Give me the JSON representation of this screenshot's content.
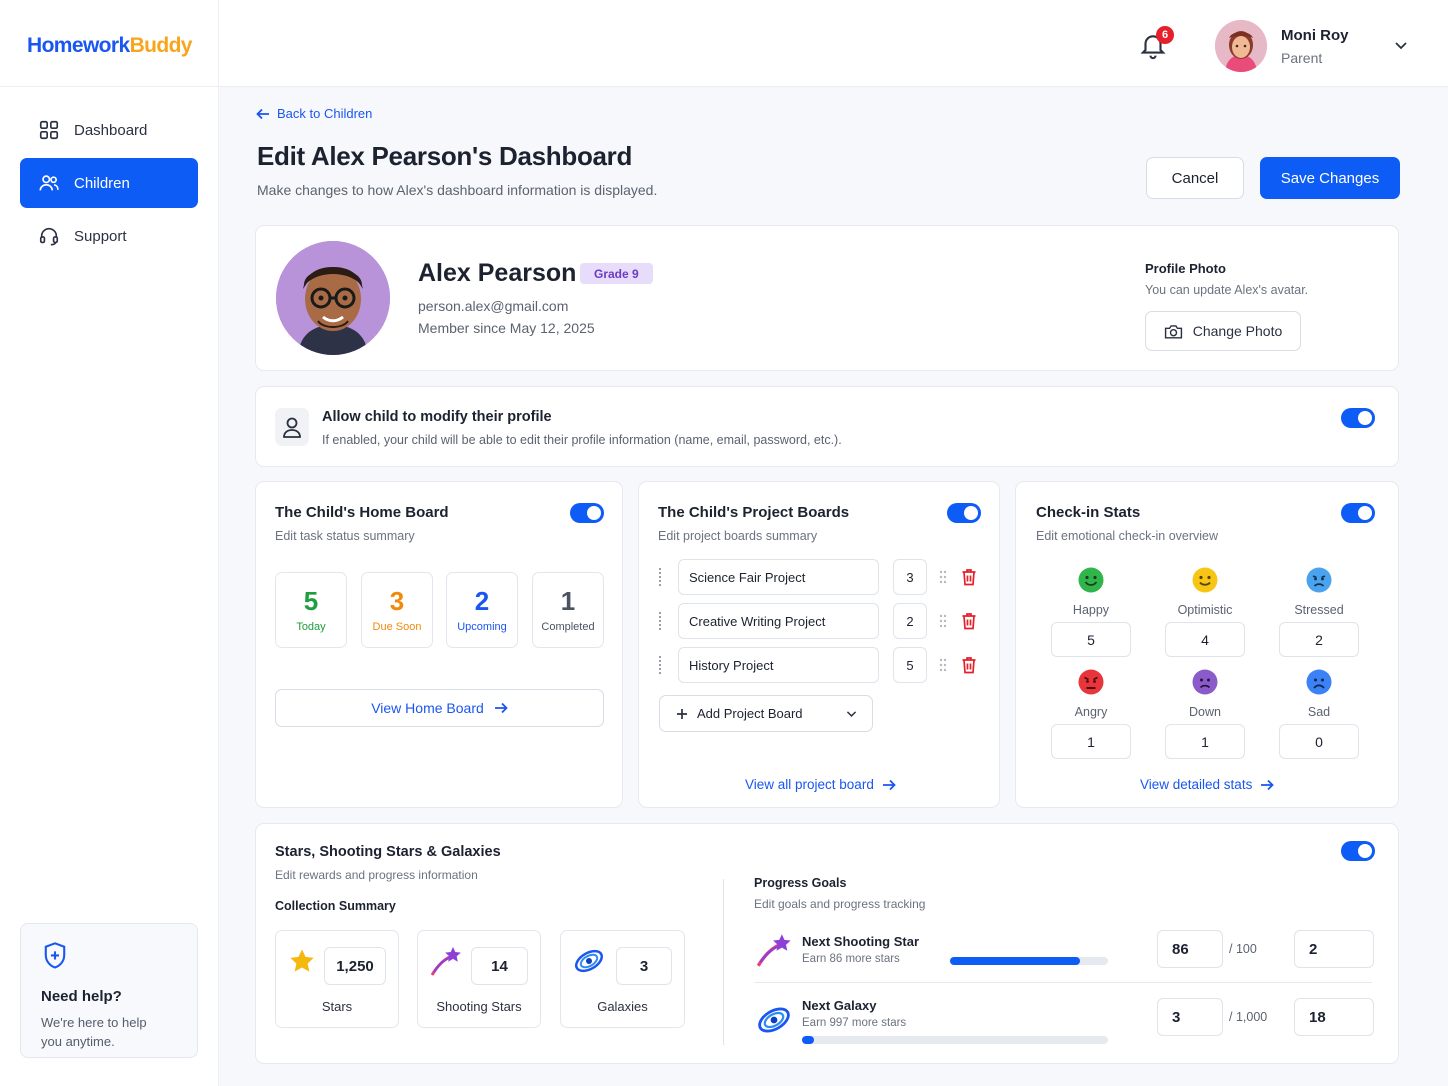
{
  "brand": {
    "part1": "Homework",
    "part2": "Buddy"
  },
  "sidebar": {
    "items": [
      {
        "label": "Dashboard",
        "icon": "grid-icon"
      },
      {
        "label": "Children",
        "icon": "users-icon"
      },
      {
        "label": "Support",
        "icon": "headset-icon"
      }
    ],
    "help": {
      "title": "Need help?",
      "text": "We're here to help you anytime."
    }
  },
  "header": {
    "notifications": "6",
    "user_name": "Moni Roy",
    "user_role": "Parent"
  },
  "page": {
    "back_label": "Back to Children",
    "title": "Edit Alex Pearson's Dashboard",
    "subtitle": "Make changes to how Alex's dashboard information is displayed.",
    "cancel_label": "Cancel",
    "save_label": "Save Changes"
  },
  "profile": {
    "name": "Alex Pearson",
    "grade": "Grade 9",
    "email": "person.alex@gmail.com",
    "member_since": "Member since May 12, 2025",
    "photo_title": "Profile Photo",
    "photo_text": "You can update Alex's avatar.",
    "change_photo_label": "Change Photo"
  },
  "permission": {
    "title": "Allow child to modify their profile",
    "text": "If enabled, your child will be able to edit their profile information (name, email, password, etc.).",
    "enabled": true
  },
  "home_board": {
    "title": "The Child's Home Board",
    "subtitle": "Edit task status summary",
    "enabled": true,
    "stats": [
      {
        "value": "5",
        "label": "Today",
        "color": "#1f9d3f"
      },
      {
        "value": "3",
        "label": "Due Soon",
        "color": "#f08a0c"
      },
      {
        "value": "2",
        "label": "Upcoming",
        "color": "#1a56f0"
      },
      {
        "value": "1",
        "label": "Completed",
        "color": "#4b5261"
      }
    ],
    "view_label": "View Home Board"
  },
  "project_boards": {
    "title": "The Child's Project Boards",
    "subtitle": "Edit project boards summary",
    "enabled": true,
    "projects": [
      {
        "name": "Science Fair Project",
        "count": "3"
      },
      {
        "name": "Creative Writing Project",
        "count": "2"
      },
      {
        "name": "History Project",
        "count": "5"
      }
    ],
    "add_label": "Add Project Board",
    "view_label": "View all project board"
  },
  "checkin": {
    "title": "Check-in Stats",
    "subtitle": "Edit emotional check-in overview",
    "enabled": true,
    "moods": [
      {
        "label": "Happy",
        "value": "5",
        "color": "#2fb54a"
      },
      {
        "label": "Optimistic",
        "value": "4",
        "color": "#f6c515"
      },
      {
        "label": "Stressed",
        "value": "2",
        "color": "#4aa3ee"
      },
      {
        "label": "Angry",
        "value": "1",
        "color": "#e8353b"
      },
      {
        "label": "Down",
        "value": "1",
        "color": "#8b5cc9"
      },
      {
        "label": "Sad",
        "value": "0",
        "color": "#3b82f6"
      }
    ],
    "view_label": "View detailed stats"
  },
  "rewards": {
    "title": "Stars, Shooting Stars & Galaxies",
    "subtitle": "Edit rewards and progress information",
    "enabled": true,
    "collection_title": "Collection Summary",
    "collection": [
      {
        "value": "1,250",
        "label": "Stars",
        "icon": "star-icon"
      },
      {
        "value": "14",
        "label": "Shooting Stars",
        "icon": "shooting-star-icon"
      },
      {
        "value": "3",
        "label": "Galaxies",
        "icon": "galaxy-icon"
      }
    ],
    "goals_title": "Progress Goals",
    "goals_subtitle": "Edit goals and progress tracking",
    "goals": [
      {
        "title": "Next Shooting Star",
        "text": "Earn 86 more stars",
        "current": "86",
        "target": "/ 100",
        "extra": "2",
        "progress": 0.82
      },
      {
        "title": "Next Galaxy",
        "text": "Earn 997 more stars",
        "current": "3",
        "target": "/ 1,000",
        "extra": "18",
        "progress": 0.04
      }
    ]
  }
}
